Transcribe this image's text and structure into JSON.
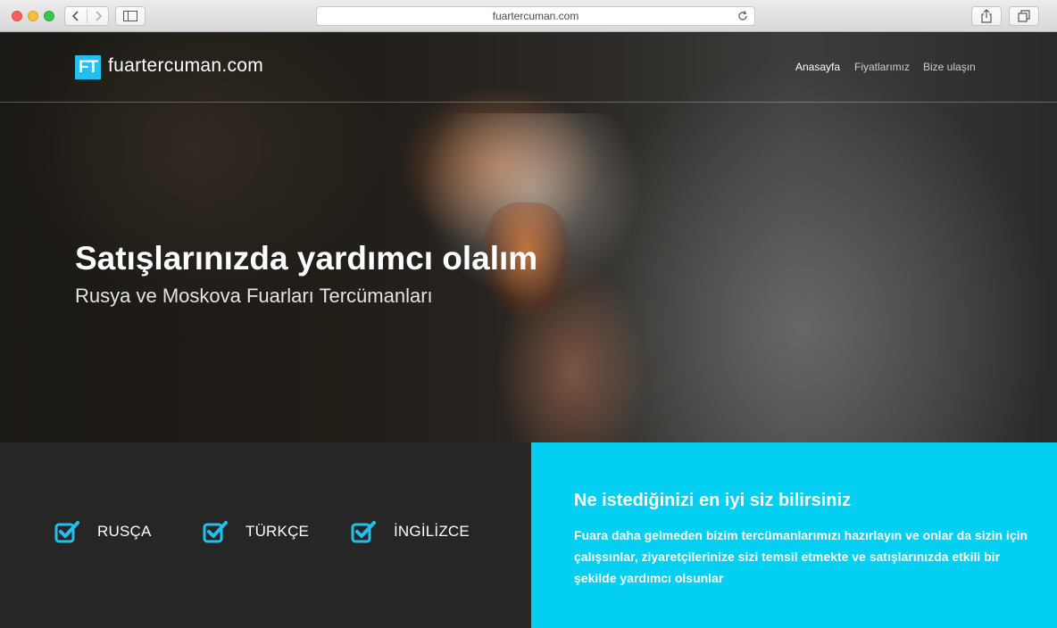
{
  "browser": {
    "url": "fuartercuman.com"
  },
  "site": {
    "logo_mark": "FT",
    "logo_text": "fuartercuman.com",
    "nav": [
      {
        "label": "Anasayfa"
      },
      {
        "label": "Fiyatlarımız"
      },
      {
        "label": "Bize ulaşın"
      }
    ]
  },
  "hero": {
    "title": "Satışlarınızda yardımcı olalım",
    "subtitle": "Rusya ve Moskova Fuarları Tercümanları"
  },
  "languages": [
    {
      "label": "RUSÇA"
    },
    {
      "label": "TÜRKÇE"
    },
    {
      "label": "İNGİLİZCE"
    }
  ],
  "promo": {
    "title": "Ne istediğinizi en iyi siz bilirsiniz",
    "text": "Fuara daha gelmeden bizim tercümanlarımızı hazırlayın ve onlar da sizin için çalışsınlar, ziyaretçilerinize sizi temsil etmekte ve satışlarınızda etkili bir şekilde yardımcı olsunlar"
  },
  "colors": {
    "accent": "#22c0ef",
    "promo_bg": "#02cff2",
    "features_bg": "#262626"
  }
}
